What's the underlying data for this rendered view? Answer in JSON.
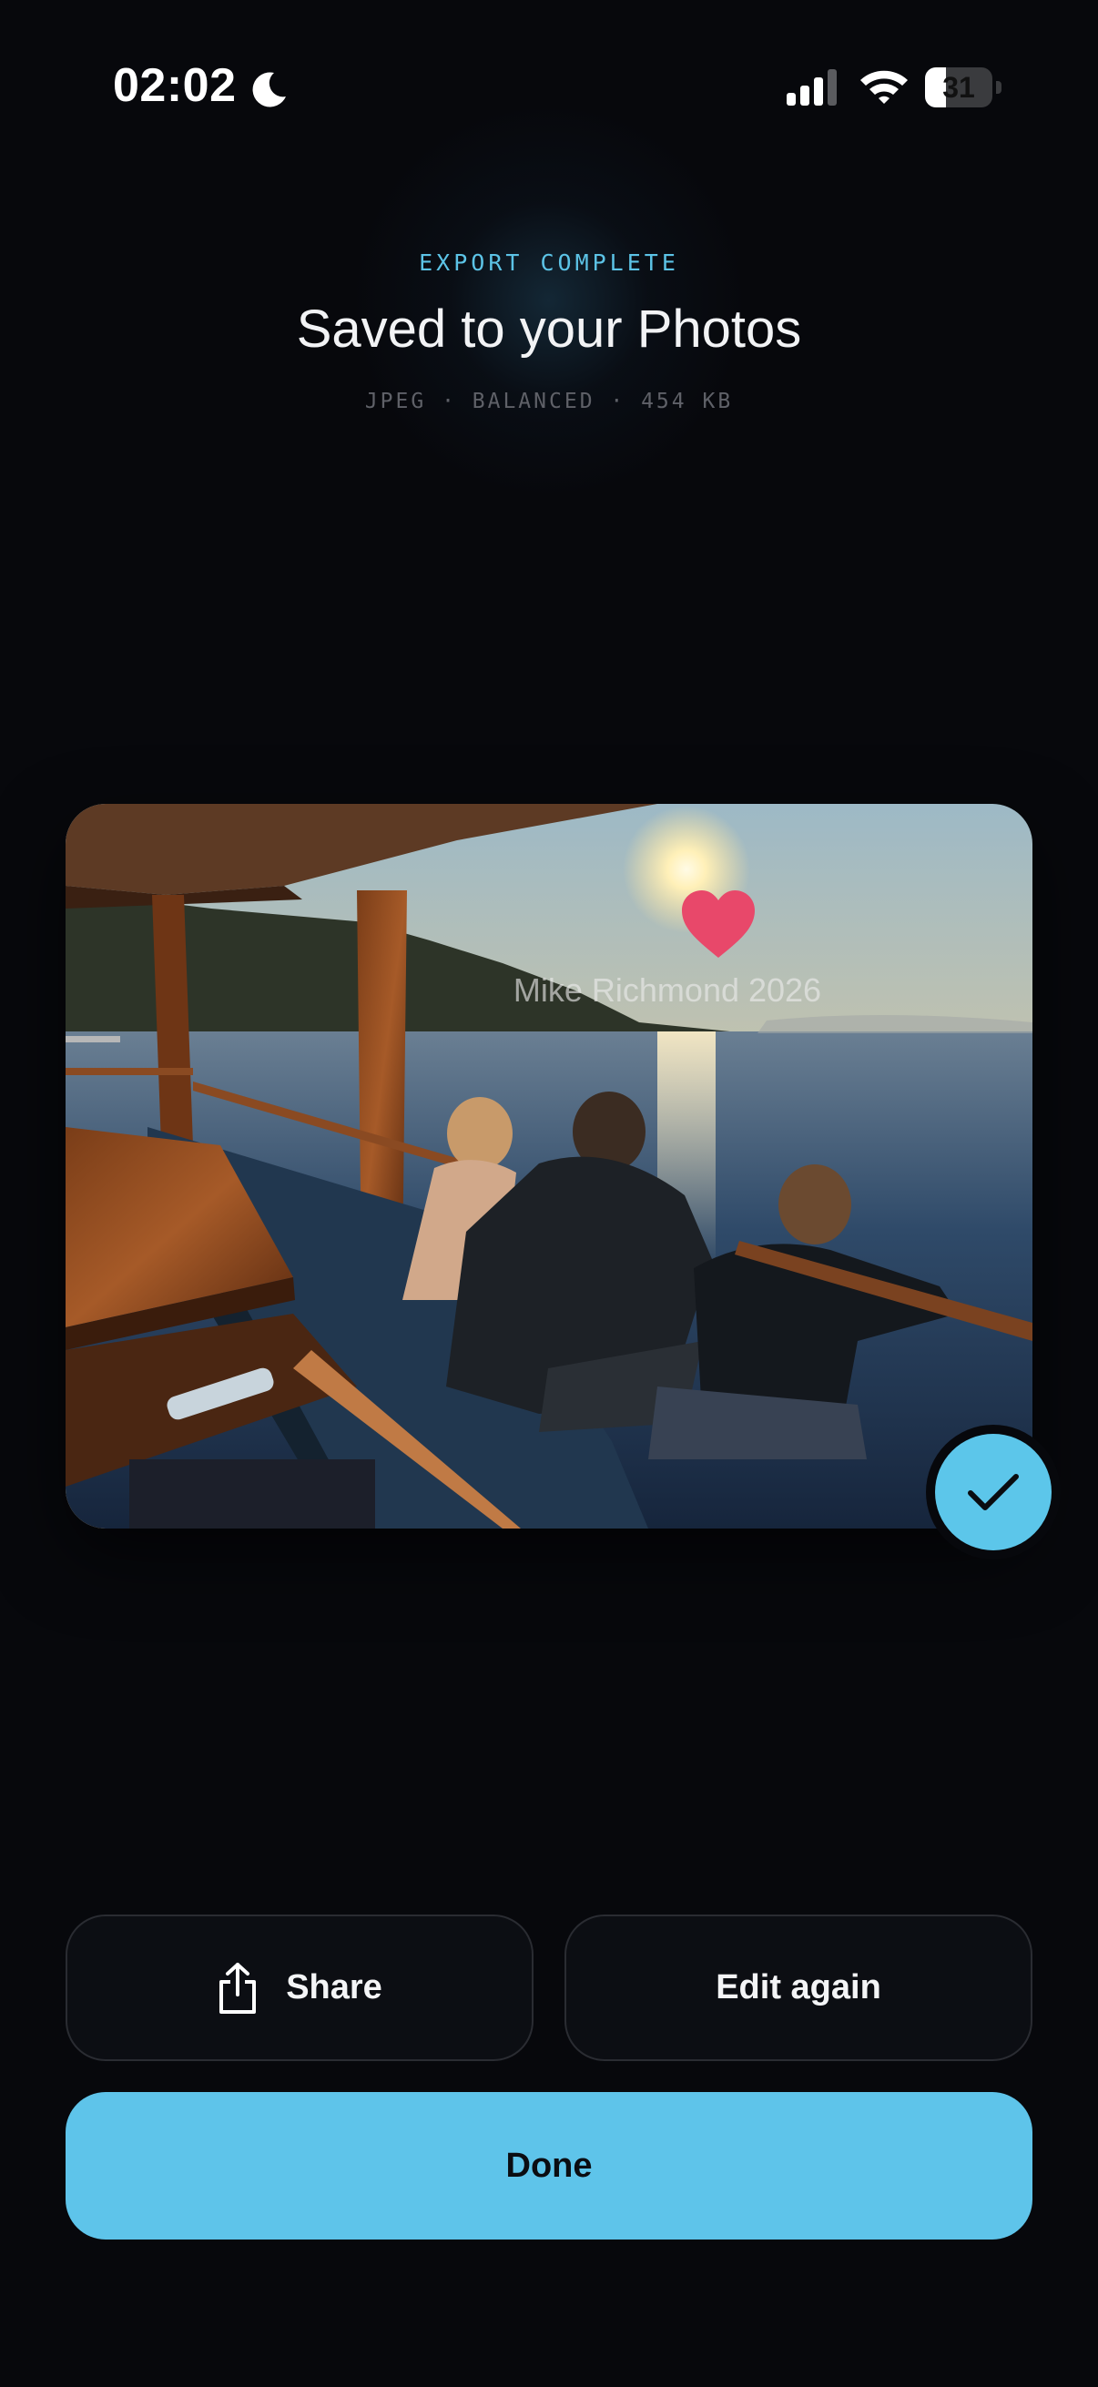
{
  "status_bar": {
    "time": "02:02",
    "battery_level": "31",
    "battery_fraction": 0.31
  },
  "header": {
    "eyebrow": "EXPORT COMPLETE",
    "title": "Saved to your Photos",
    "meta": "JPEG · BALANCED · 454 KB"
  },
  "preview": {
    "watermark": "Mike Richmond 2026",
    "heart_icon": "heart-icon",
    "check_icon": "checkmark-icon"
  },
  "actions": {
    "share_label": "Share",
    "edit_label": "Edit again",
    "done_label": "Done"
  },
  "colors": {
    "accent": "#5cc6ea",
    "background": "#07080c",
    "heart": "#e8486a"
  }
}
